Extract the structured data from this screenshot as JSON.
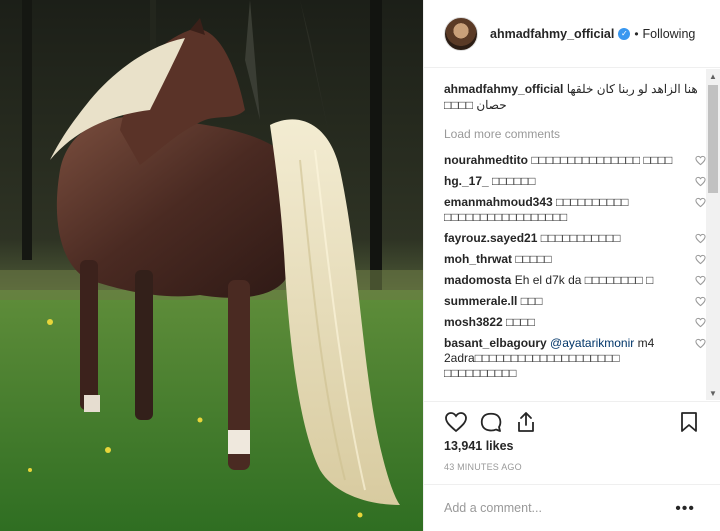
{
  "header": {
    "username": "ahmadfahmy_official",
    "separator": "•",
    "follow_status": "Following"
  },
  "caption": {
    "username": "ahmadfahmy_official",
    "text": "هنا الزاهد لو ربنا كان خلقها حصان □□□□"
  },
  "load_more_label": "Load more comments",
  "comments": [
    {
      "user": "nourahmedtito",
      "text": "□□□□□□□□□□□□□□□ □□□□"
    },
    {
      "user": "hg._17_",
      "text": "□□□□□□"
    },
    {
      "user": "emanmahmoud343",
      "text": "□□□□□□□□□□ □□□□□□□□□□□□□□□□□"
    },
    {
      "user": "fayrouz.sayed21",
      "text": "□□□□□□□□□□□"
    },
    {
      "user": "moh_thrwat",
      "text": "□□□□□"
    },
    {
      "user": "madomosta",
      "text": "Eh el d7k da □□□□□□□□ □"
    },
    {
      "user": "summerale.ll",
      "text": "□□□"
    },
    {
      "user": "mosh3822",
      "text": "□□□□"
    },
    {
      "user": "basant_elbagoury",
      "mention": "@ayatarikmonir",
      "text": "m4 2adra□□□□□□□□□□□□□□□□□□□□ □□□□□□□□□□"
    }
  ],
  "likes": "13,941 likes",
  "timestamp": "43 MINUTES AGO",
  "add_comment_placeholder": "Add a comment...",
  "more_label": "•••",
  "icons": {
    "verified": "verified-badge-icon",
    "like": "heart-icon",
    "comment": "comment-bubble-icon",
    "share": "share-icon",
    "save": "bookmark-icon",
    "comment_like": "small-heart-icon",
    "more": "more-options-icon"
  },
  "colors": {
    "verified_blue": "#3897f0",
    "muted_text": "#999999",
    "border": "#efefef",
    "mention": "#003569"
  }
}
